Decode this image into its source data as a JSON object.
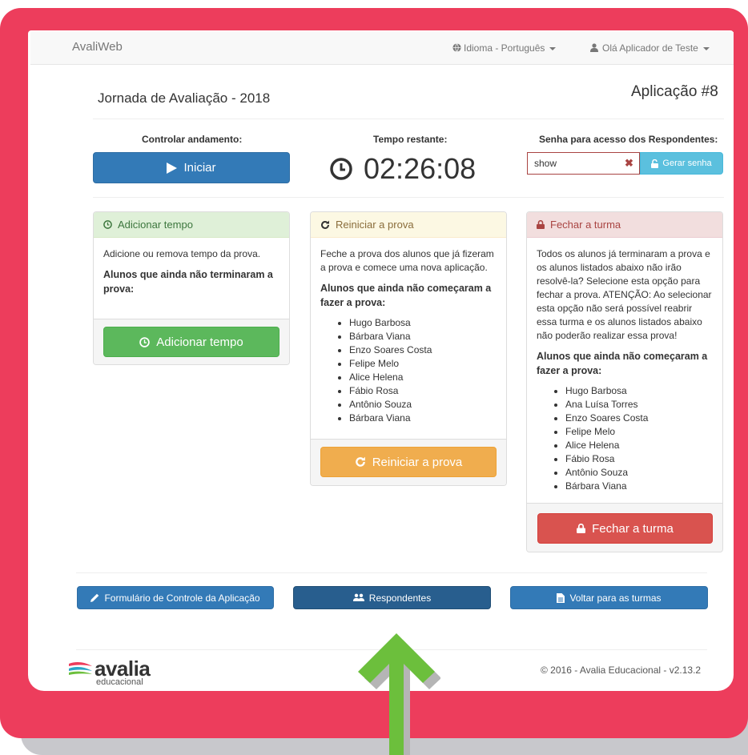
{
  "app": {
    "brand": "AvaliWeb"
  },
  "nav": {
    "language": "Idioma - Português",
    "user": "Olá Aplicador de Teste"
  },
  "page": {
    "title": "Jornada de Avaliação - 2018",
    "application": "Aplicação #8"
  },
  "controls": {
    "progress_label": "Controlar andamento:",
    "start_button": "Iniciar",
    "time_label": "Tempo restante:",
    "time_value": "02:26:08",
    "password_label": "Senha para acesso dos Respondentes:",
    "password_value": "show",
    "generate_button": "Gerar senha"
  },
  "panels": {
    "add_time": {
      "title": "Adicionar tempo",
      "description": "Adicione ou remova tempo da prova.",
      "subtitle": "Alunos que ainda não terminaram a prova:",
      "button": "Adicionar tempo"
    },
    "restart": {
      "title": "Reiniciar a prova",
      "description": "Feche a prova dos alunos que já fizeram a prova e comece uma nova aplicação.",
      "subtitle": "Alunos que ainda não começaram a fazer a prova:",
      "students": [
        "Hugo Barbosa",
        "Bárbara Viana",
        "Enzo Soares Costa",
        "Felipe Melo",
        "Alice Helena",
        "Fábio Rosa",
        "Antônio Souza",
        "Bárbara Viana"
      ],
      "button": "Reiniciar a prova"
    },
    "close": {
      "title": "Fechar a turma",
      "description": "Todos os alunos já terminaram a prova e os alunos listados abaixo não irão resolvê-la? Selecione esta opção para fechar a prova. ATENÇÃO: Ao selecionar esta opção não será possível reabrir essa turma e os alunos listados abaixo não poderão realizar essa prova!",
      "subtitle": "Alunos que ainda não começaram a fazer a prova:",
      "students": [
        "Hugo Barbosa",
        "Ana Luísa Torres",
        "Enzo Soares Costa",
        "Felipe Melo",
        "Alice Helena",
        "Fábio Rosa",
        "Antônio Souza",
        "Bárbara Viana"
      ],
      "button": "Fechar a turma"
    }
  },
  "bottom_buttons": {
    "form": "Formulário de Controle da Aplicação",
    "respondents": "Respondentes",
    "back": "Voltar para as turmas"
  },
  "footer": {
    "logo_word": "avalia",
    "logo_sub": "educacional",
    "copyright": "© 2016 - Avalia Educacional - v2.13.2"
  },
  "colors": {
    "frame": "#ed3d5c",
    "arrow": "#6cbf3c",
    "primary": "#337ab7",
    "success": "#5cb85c",
    "warning": "#f0ad4e",
    "danger": "#d9534f"
  },
  "icons": [
    "globe-icon",
    "user-icon",
    "play-icon",
    "clock-icon",
    "unlock-icon",
    "undo-icon",
    "lock-icon",
    "pencil-icon",
    "users-icon",
    "file-icon",
    "arrow-up-icon"
  ]
}
